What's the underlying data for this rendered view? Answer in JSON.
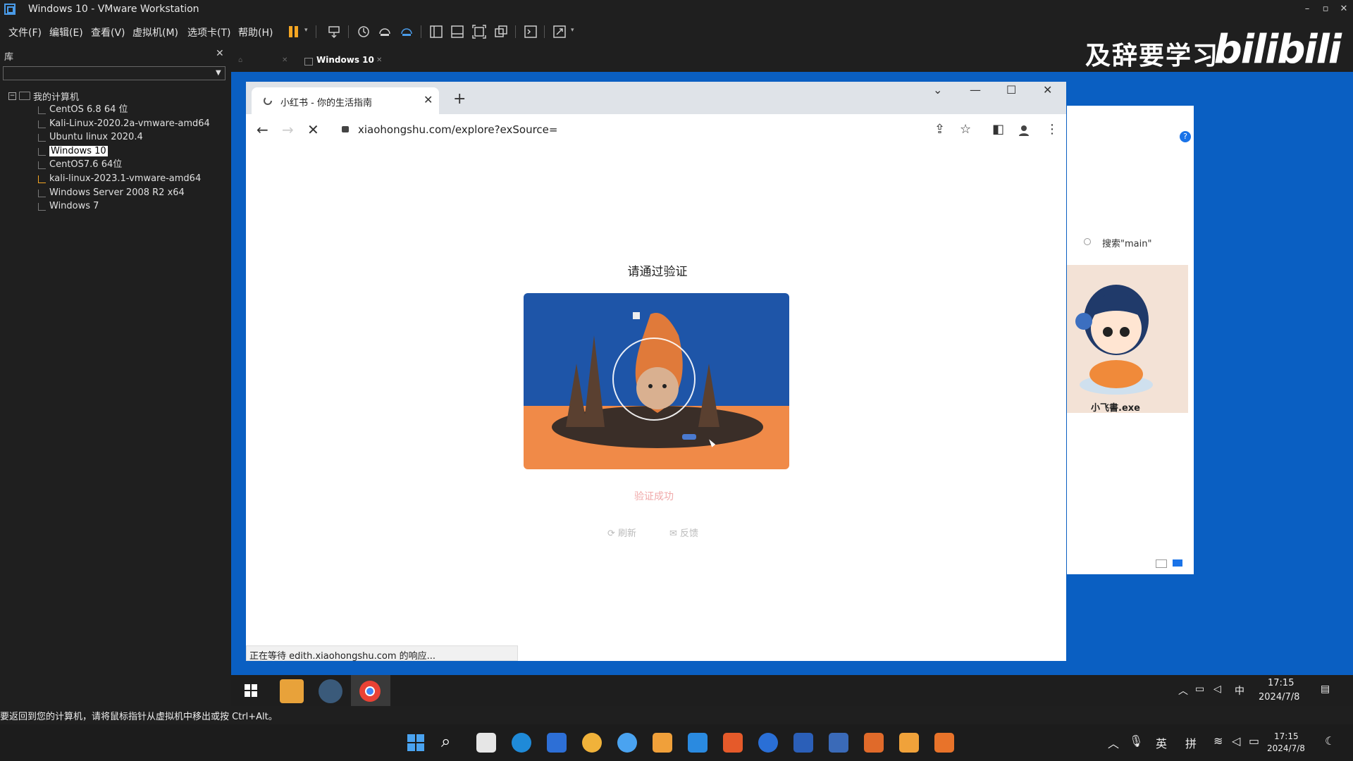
{
  "host": {
    "title": "Windows 10 - VMware Workstation",
    "menu": [
      "文件(F)",
      "编辑(E)",
      "查看(V)",
      "虚拟机(M)",
      "选项卡(T)",
      "帮助(H)"
    ],
    "status_hint": "要返回到您的计算机，请将鼠标指针从虚拟机中移出或按 Ctrl+Alt。"
  },
  "overlay": {
    "text": "及辞要学习",
    "logo": "bilibili"
  },
  "library": {
    "label": "库",
    "root": "我的计算机",
    "items": [
      "CentOS 6.8 64 位",
      "Kali-Linux-2020.2a-vmware-amd64",
      "Ubuntu linux 2020.4",
      "Windows 10",
      "CentOS7.6 64位",
      "kali-linux-2023.1-vmware-amd64",
      "Windows Server 2008 R2 x64",
      "Windows 7"
    ],
    "selected_index": 3
  },
  "vm": {
    "tab": "Windows 10"
  },
  "browser": {
    "tab_title": "小红书 - 你的生活指南",
    "url": "xiaohongshu.com/explore?exSource=",
    "verify_title": "请通过验证",
    "verify_status": "验证成功",
    "refresh": "刷新",
    "feedback": "反馈",
    "status": "正在等待 edith.xiaohongshu.com 的响应..."
  },
  "bg_window": {
    "search": "搜索\"main\"",
    "avatar_name": "小飞書.exe"
  },
  "guest_taskbar": {
    "time": "17:15",
    "date": "2024/7/8",
    "ime": "中"
  },
  "host_taskbar": {
    "time": "17:15",
    "date": "2024/7/8",
    "lang": "英",
    "ime": "拼"
  },
  "colors": {
    "desktop": "#0a5fc2",
    "accent": "#1a73e8",
    "verify_ok": "#f0a9a9",
    "pause": "#f5a623"
  }
}
